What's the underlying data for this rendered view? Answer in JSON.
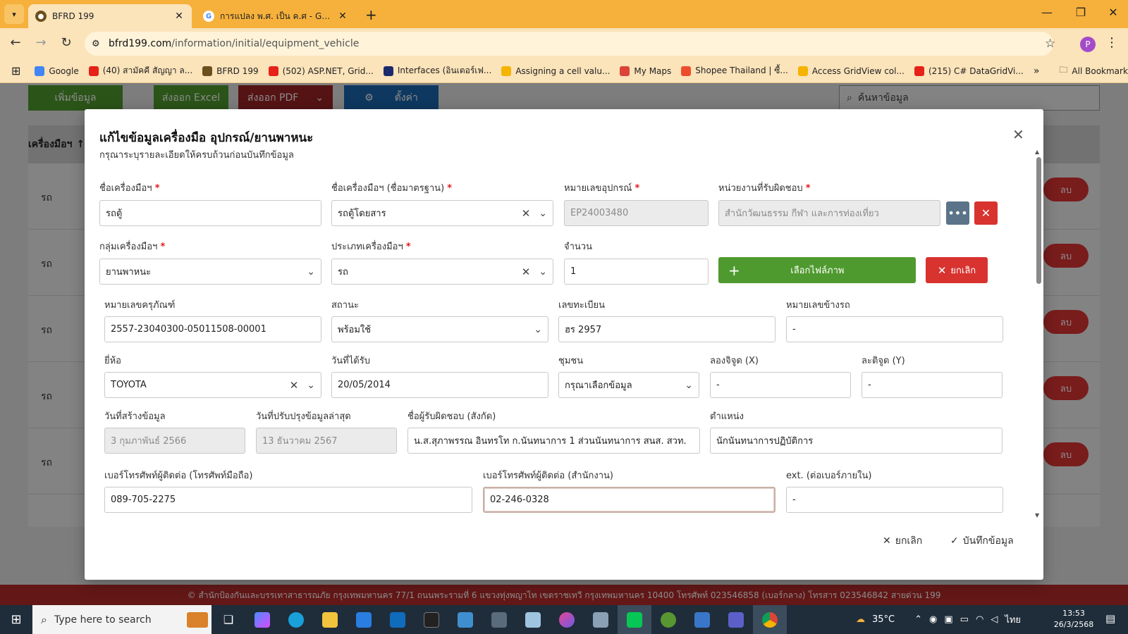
{
  "browser": {
    "tabs": [
      {
        "title": "BFRD 199",
        "active": true
      },
      {
        "title": "การแปลง พ.ศ. เป็น ค.ศ - Google S",
        "active": false
      }
    ],
    "url_host": "bfrd199.com",
    "url_path": "/information/initial/equipment_vehicle",
    "profile_initial": "P",
    "bookmarks": [
      {
        "label": "Google",
        "color": "#4285f4"
      },
      {
        "label": "(40) สามัคคี สัญญา ล...",
        "color": "#e62117"
      },
      {
        "label": "BFRD 199",
        "color": "#6b4f1d"
      },
      {
        "label": "(502) ASP.NET, Grid...",
        "color": "#e62117"
      },
      {
        "label": "Interfaces (อินเตอร์เฟ...",
        "color": "#1a2a6c"
      },
      {
        "label": "Assigning a cell valu...",
        "color": "#f4b400"
      },
      {
        "label": "My Maps",
        "color": "#db4437"
      },
      {
        "label": "Shopee Thailand | ซื้...",
        "color": "#ee4d2d"
      },
      {
        "label": "Access GridView col...",
        "color": "#f4b400"
      },
      {
        "label": "(215) C# DataGridVi...",
        "color": "#e62117"
      }
    ],
    "all_bookmarks": "All Bookmarks"
  },
  "page": {
    "buttons": {
      "add": "เพิ่มข้อมูล",
      "excel": "ส่งออก Excel",
      "pdf": "ส่งออก PDF",
      "settings": "ตั้งค่า"
    },
    "search_placeholder": "ค้นหาข้อมูล",
    "table_header": "เครื่องมือฯ",
    "row_value": "รถ",
    "delete_label": "ลบ",
    "footer": "© สำนักป้องกันและบรรเทาสาธารณภัย กรุงเทพมหานคร 77/1 ถนนพระรามที่ 6 แขวงทุ่งพญาไท เขตราชเทวี กรุงเทพมหานคร 10400 โทรศัพท์ 023546858 (เบอร์กลาง) โทรสาร 023546842 สายด่วน 199"
  },
  "modal": {
    "title": "แก้ไขข้อมูลเครื่องมือ อุปกรณ์/ยานพาหนะ",
    "subtitle": "กรุณาระบุรายละเอียดให้ครบถ้วนก่อนบันทึกข้อมูล",
    "fields": {
      "tool_name": {
        "label": "ชื่อเครื่องมือฯ",
        "value": "รถตู้"
      },
      "std_name": {
        "label": "ชื่อเครื่องมือฯ (ชื่อมาตรฐาน)",
        "value": "รถตู้โดยสาร"
      },
      "equip_no": {
        "label": "หมายเลขอุปกรณ์",
        "value": "EP24003480"
      },
      "dept": {
        "label": "หน่วยงานที่รับผิดชอบ",
        "value": "สำนักวัฒนธรรม กีฬา และการท่องเที่ยว"
      },
      "group": {
        "label": "กลุ่มเครื่องมือฯ",
        "value": "ยานพาหนะ"
      },
      "type": {
        "label": "ประเภทเครื่องมือฯ",
        "value": "รถ"
      },
      "qty": {
        "label": "จำนวน",
        "value": "1"
      },
      "asset_no": {
        "label": "หมายเลขครุภัณฑ์",
        "value": "2557-23040300-05011508-00001"
      },
      "status": {
        "label": "สถานะ",
        "value": "พร้อมใช้"
      },
      "plate": {
        "label": "เลขทะเบียน",
        "value": "ฮร 2957"
      },
      "side_no": {
        "label": "หมายเลขข้างรถ",
        "value": "-"
      },
      "brand": {
        "label": "ยี่ห้อ",
        "value": "TOYOTA"
      },
      "received": {
        "label": "วันที่ได้รับ",
        "value": "20/05/2014"
      },
      "community": {
        "label": "ชุมชน",
        "value": "กรุณาเลือกข้อมูล"
      },
      "lon": {
        "label": "ลองจิจูด (X)",
        "value": "-"
      },
      "lat": {
        "label": "ละติจูด (Y)",
        "value": "-"
      },
      "created": {
        "label": "วันที่สร้างข้อมูล",
        "value": "3 กุมภาพันธ์ 2566"
      },
      "updated": {
        "label": "วันที่ปรับปรุงข้อมูลล่าสุด",
        "value": "13 ธันวาคม 2567"
      },
      "owner": {
        "label": "ชื่อผู้รับผิดชอบ (สังกัด)",
        "value": "น.ส.สุภาพรรณ อินทรโท ก.นันทนาการ 1 ส่วนนันทนาการ สนส. สวท."
      },
      "position": {
        "label": "ตำแหน่ง",
        "value": "นักนันทนาการปฏิบัติการ"
      },
      "mobile": {
        "label": "เบอร์โทรศัพท์ผู้ติดต่อ (โทรศัพท์มือถือ)",
        "value": "089-705-2275"
      },
      "office": {
        "label": "เบอร์โทรศัพท์ผู้ติดต่อ (สำนักงาน)",
        "value": "02-246-0328"
      },
      "ext": {
        "label": "ext. (ต่อเบอร์ภายใน)",
        "value": "-"
      }
    },
    "choose_image": "เลือกไฟล์ภาพ",
    "cancel_image": "ยกเลิก",
    "footer_cancel": "ยกเลิก",
    "footer_save": "บันทึกข้อมูล"
  },
  "taskbar": {
    "search_placeholder": "Type here to search",
    "weather": "35°C",
    "lang": "ไทย",
    "time": "13:53",
    "date": "26/3/2568"
  },
  "colors": {
    "green": "#4f9a2e",
    "red": "#d8332f",
    "steel": "#5b7489",
    "blue": "#1b66b0",
    "darkred": "#9c2326"
  }
}
